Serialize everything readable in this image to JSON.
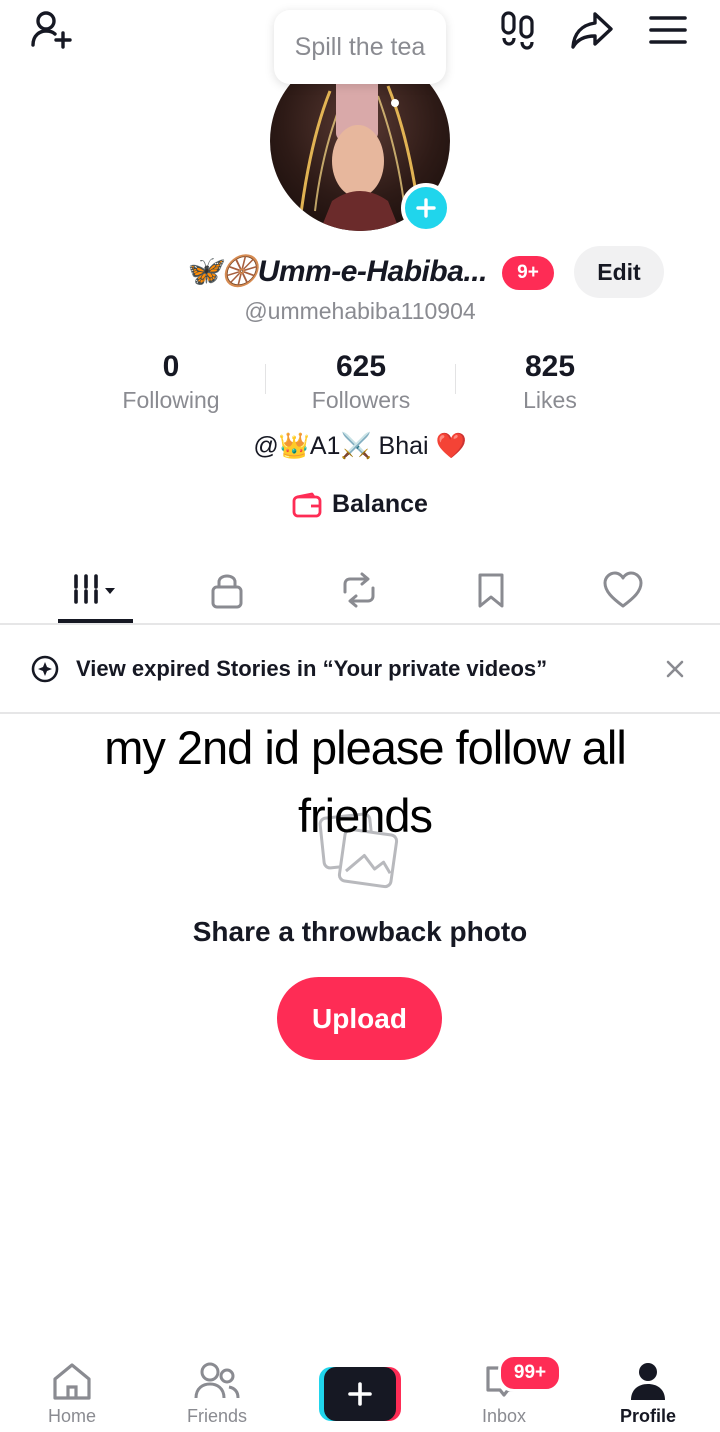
{
  "header": {
    "prompt_bubble": "Spill the tea"
  },
  "profile": {
    "display_name": "🦋🛞Umm-e-Habiba...",
    "notification_badge": "9+",
    "edit_label": "Edit",
    "handle": "@ummehabiba110904",
    "stats": [
      {
        "value": "0",
        "label": "Following"
      },
      {
        "value": "625",
        "label": "Followers"
      },
      {
        "value": "825",
        "label": "Likes"
      }
    ],
    "bio": "@👑A1⚔️ Bhai ❤️",
    "balance_label": "Balance"
  },
  "tabs": [
    "videos-grid",
    "private",
    "reposts",
    "favorites",
    "liked"
  ],
  "notice": {
    "text": "View expired Stories in “Your private videos”"
  },
  "overlay_caption": "my 2nd id please follow all friends",
  "empty_state": {
    "text": "Share a throwback photo",
    "upload_label": "Upload"
  },
  "bottom_nav": {
    "home": "Home",
    "friends": "Friends",
    "inbox": "Inbox",
    "inbox_badge": "99+",
    "profile": "Profile"
  },
  "colors": {
    "accent": "#fe2c55",
    "cyan": "#20d5ec",
    "text": "#161823",
    "muted": "#8a8b91"
  }
}
